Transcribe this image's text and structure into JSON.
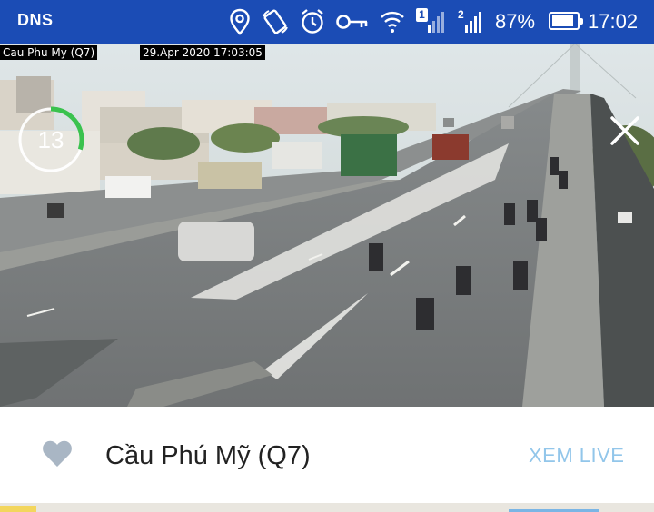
{
  "status_bar": {
    "carrier": "DNS",
    "sim1": "1",
    "sim2": "2",
    "battery_percent": "87%",
    "battery_level": 0.87,
    "time": "17:02",
    "icons": [
      "location-icon",
      "rotate-icon",
      "alarm-icon",
      "key-icon",
      "wifi-icon",
      "signal-sim1-icon",
      "signal-sim2-icon",
      "battery-icon"
    ]
  },
  "camera": {
    "name_label": "Cau Phu My (Q7)",
    "timestamp": "29.Apr 2020  17:03:05",
    "countdown": "13",
    "countdown_progress": 0.3,
    "accent_color": "#3ac24e"
  },
  "sheet": {
    "title": "Cầu Phú Mỹ (Q7)",
    "live_label": "XEM LIVE",
    "favorite_color": "#a9b6c4",
    "live_color": "#92c6ea"
  }
}
